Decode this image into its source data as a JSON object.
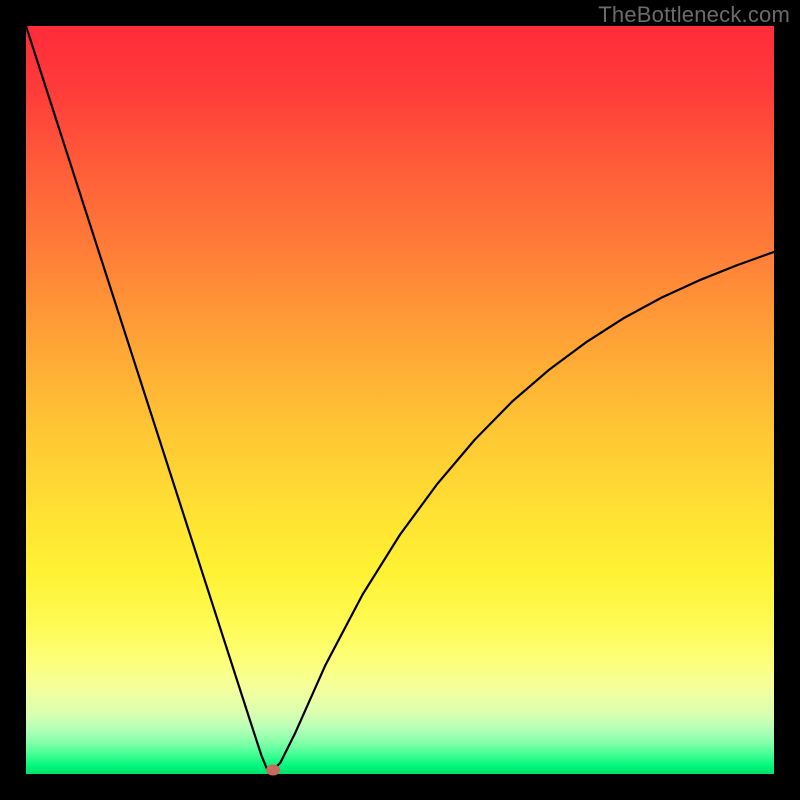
{
  "watermark": "TheBottleneck.com",
  "colors": {
    "frame": "#000000",
    "curve": "#000000",
    "marker": "#c86a5d",
    "gradient_top": "#ff2c3a",
    "gradient_mid": "#ffe133",
    "gradient_bottom": "#00e06a"
  },
  "chart_data": {
    "type": "line",
    "title": "",
    "xlabel": "",
    "ylabel": "",
    "xlim": [
      0,
      100
    ],
    "ylim": [
      0,
      100
    ],
    "grid": false,
    "series": [
      {
        "name": "bottleneck-curve",
        "x": [
          0,
          5,
          10,
          15,
          20,
          25,
          28,
          30,
          31.5,
          32.5,
          34,
          36,
          38,
          40,
          45,
          50,
          55,
          60,
          65,
          70,
          75,
          80,
          85,
          90,
          95,
          100
        ],
        "y": [
          100,
          84.5,
          69,
          53.5,
          38,
          22.5,
          13.2,
          7.0,
          2.4,
          0.0,
          1.5,
          5.5,
          10.0,
          14.5,
          24.0,
          32.0,
          38.8,
          44.7,
          49.8,
          54.1,
          57.8,
          61.0,
          63.7,
          66.0,
          68.0,
          69.8
        ]
      }
    ],
    "marker": {
      "x": 33.0,
      "y": 0.5
    },
    "background_gradient": {
      "direction": "vertical",
      "stops": [
        {
          "pos": 0.0,
          "color": "#ff2c3a"
        },
        {
          "pos": 0.3,
          "color": "#ff7d38"
        },
        {
          "pos": 0.55,
          "color": "#ffc634"
        },
        {
          "pos": 0.73,
          "color": "#fff233"
        },
        {
          "pos": 0.89,
          "color": "#f2ffa0"
        },
        {
          "pos": 0.96,
          "color": "#7dffa8"
        },
        {
          "pos": 1.0,
          "color": "#00e06a"
        }
      ]
    }
  }
}
